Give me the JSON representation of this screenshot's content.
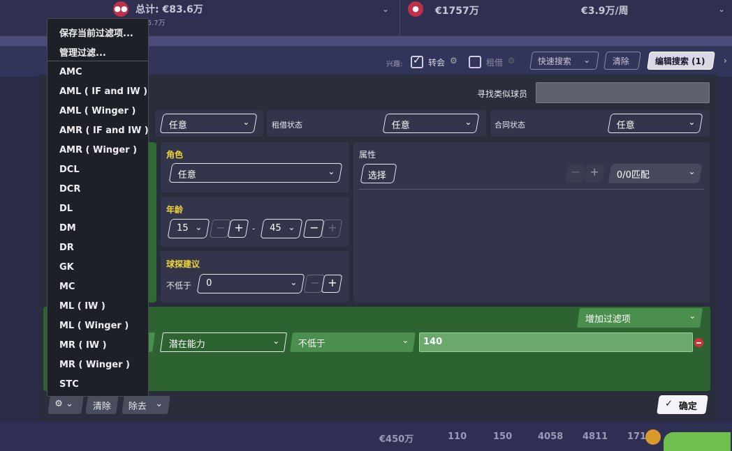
{
  "topbar": {
    "total_label": "总计: €83.6万",
    "total_sub": "€55.7万",
    "wage_total": "€1757万",
    "wage_week": "€3.9万/周"
  },
  "filterbar": {
    "interest_label": "兴趣:",
    "transfer_label": "转会",
    "transfer_checked": true,
    "loan_label": "租借",
    "loan_checked": false,
    "quick_search": "快速搜索",
    "clear": "清除",
    "edit_search": "编辑搜索 (1)"
  },
  "panel": {
    "similar_label": "寻找类似球员",
    "similar_value": "",
    "row1": {
      "first_value": "任意",
      "loan_status_label": "租借状态",
      "loan_status_value": "任意",
      "contract_status_label": "合同状态",
      "contract_status_value": "任意"
    },
    "role": {
      "label": "角色",
      "value": "任意"
    },
    "age": {
      "label": "年龄",
      "min": "15",
      "max": "45",
      "dash": "-"
    },
    "scout": {
      "label": "球探建议",
      "prefix": "不低于",
      "value": "0"
    },
    "attributes": {
      "label": "属性",
      "select": "选择",
      "match": "0/0匹配"
    },
    "green": {
      "add_filter": "增加过滤项",
      "field": "潜在能力",
      "op": "不低于",
      "value": "140"
    },
    "footer": {
      "clear": "清除",
      "remove": "除去",
      "confirm": "确定"
    }
  },
  "dropdown": {
    "top_items": [
      "保存当前过滤项...",
      "管理过滤..."
    ],
    "positions": [
      "AMC",
      "AML ( IF and IW )",
      "AML ( Winger )",
      "AMR ( IF and IW )",
      "AMR ( Winger )",
      "DCL",
      "DCR",
      "DL",
      "DM",
      "DR",
      "GK",
      "MC",
      "ML ( IW )",
      "ML ( Winger )",
      "MR ( IW )",
      "MR ( Winger )",
      "STC"
    ]
  },
  "bottom": {
    "values": [
      "€450万",
      "110",
      "150",
      "4058",
      "4811",
      "1716"
    ]
  },
  "colors": {
    "background": "#2b2c4a",
    "panel": "#2a2d3c",
    "green_zone": "#2d6331",
    "accent_yellow": "#f0d53a",
    "danger": "#d8313a"
  }
}
